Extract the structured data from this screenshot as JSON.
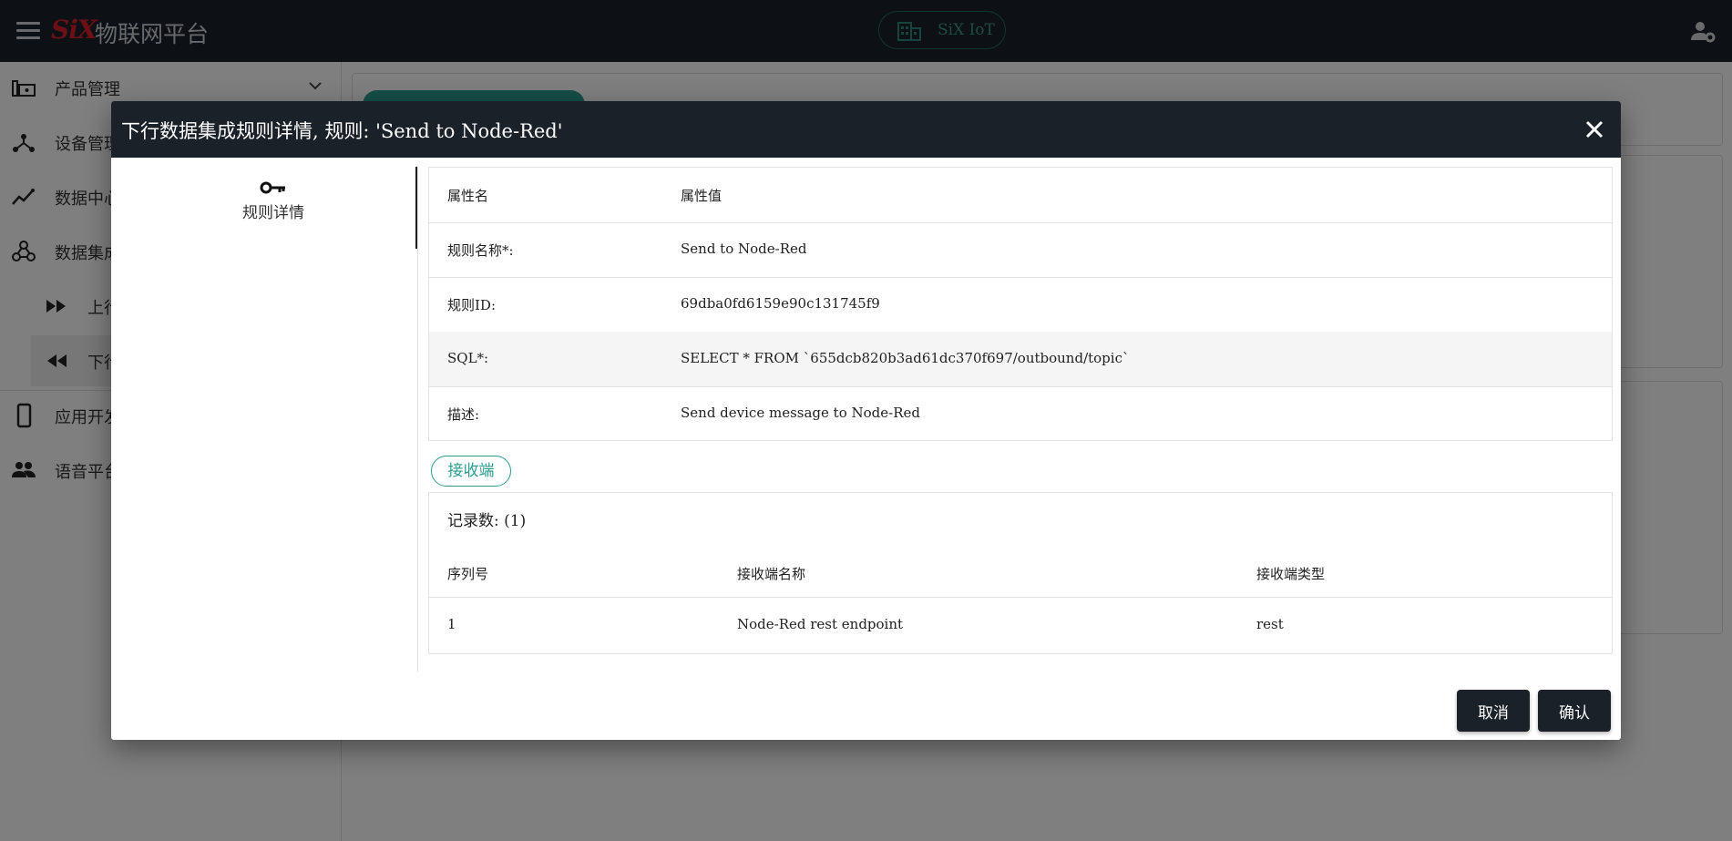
{
  "app": {
    "logo_text": "SiX",
    "title": "物联网平台",
    "center_badge": "SiX IoT"
  },
  "sidebar": {
    "items": [
      {
        "label": "产品管理",
        "icon": "devices-icon"
      },
      {
        "label": "设备管理",
        "icon": "hub-icon"
      },
      {
        "label": "数据中心",
        "icon": "analytics-icon"
      },
      {
        "label": "数据集成",
        "icon": "webhook-icon"
      },
      {
        "label": "上行",
        "icon": "fast-forward-icon"
      },
      {
        "label": "下行",
        "icon": "fast-rewind-icon"
      },
      {
        "label": "应用开发",
        "icon": "smartphone-icon"
      },
      {
        "label": "语音平台",
        "icon": "people-icon"
      }
    ]
  },
  "dialog": {
    "title": "下行数据集成规则详情, 规则: 'Send to Node-Red'",
    "tab_label": "规则详情",
    "props_header": {
      "key": "属性名",
      "value": "属性值"
    },
    "props": [
      {
        "key": "规则名称*:",
        "value": "Send to Node-Red"
      },
      {
        "key": "规则ID:",
        "value": "69dba0fd6159e90c131745f9"
      },
      {
        "key": "SQL*:",
        "value": "SELECT * FROM `655dcb820b3ad61dc370f697/outbound/topic`"
      },
      {
        "key": "描述:",
        "value": "Send device message to Node-Red"
      }
    ],
    "receivers_chip": "接收端",
    "receivers": {
      "count_label": "记录数: (1)",
      "columns": [
        "序列号",
        "接收端名称",
        "接收端类型"
      ],
      "rows": [
        [
          "1",
          "Node-Red rest endpoint",
          "rest"
        ]
      ]
    },
    "cancel_label": "取消",
    "confirm_label": "确认"
  }
}
